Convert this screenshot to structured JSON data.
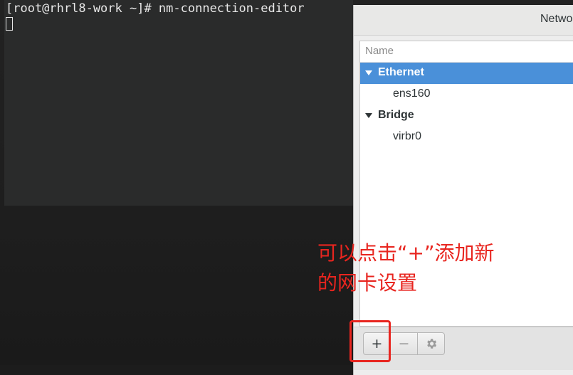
{
  "terminal": {
    "prompt_line": "[root@rhrl8-work ~]# nm-connection-editor"
  },
  "dialog": {
    "title": "Netwo",
    "column_header": "Name",
    "groups": [
      {
        "label": "Ethernet",
        "selected": true,
        "children": [
          "ens160"
        ]
      },
      {
        "label": "Bridge",
        "selected": false,
        "children": [
          "virbr0"
        ]
      }
    ],
    "toolbar": {
      "add_label": "+",
      "remove_label": "−",
      "settings_icon": "gear-icon"
    }
  },
  "annotation": {
    "text": "可以点击“+”添加新\n的网卡设置"
  },
  "colors": {
    "selection": "#4a90d9",
    "annotation": "#e8251f"
  }
}
